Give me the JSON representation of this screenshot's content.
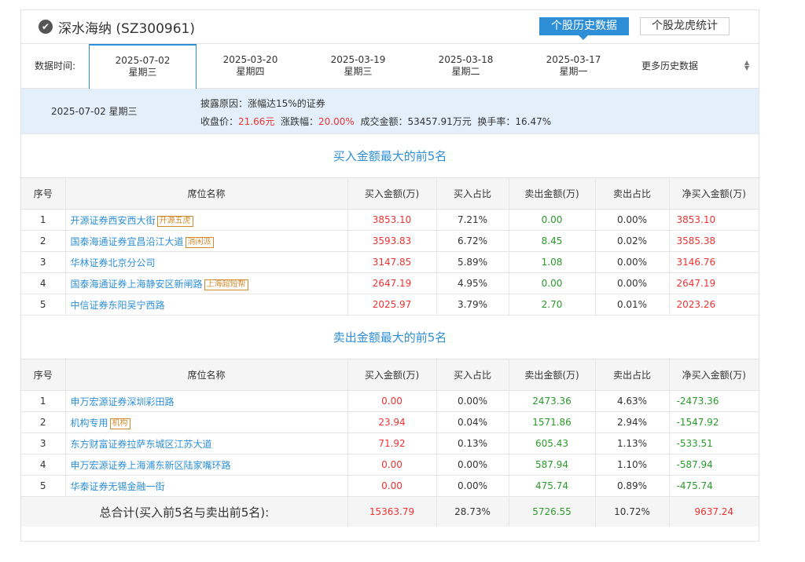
{
  "header": {
    "title": "深水海纳 (SZ300961)",
    "btn_history": "个股历史数据",
    "btn_lhb": "个股龙虎统计"
  },
  "datebar": {
    "label": "数据时间:",
    "tabs": [
      {
        "date": "2025-07-02",
        "weekday": "星期三"
      },
      {
        "date": "2025-03-20",
        "weekday": "星期四"
      },
      {
        "date": "2025-03-19",
        "weekday": "星期三"
      },
      {
        "date": "2025-03-18",
        "weekday": "星期二"
      },
      {
        "date": "2025-03-17",
        "weekday": "星期一"
      }
    ],
    "more": "更多历史数据"
  },
  "info": {
    "date": "2025-07-02  星期三",
    "reason_label": "披露原因：",
    "reason": "涨幅达15%的证券",
    "close_label": "收盘价：",
    "close": "21.66元",
    "change_label": "涨跌幅：",
    "change": "20.00%",
    "amount_label": "成交金额：",
    "amount": "53457.91万元",
    "turnover_label": "换手率：",
    "turnover": "16.47%"
  },
  "columns": [
    "序号",
    "席位名称",
    "买入金额(万)",
    "买入占比",
    "卖出金额(万)",
    "卖出占比",
    "净买入金额(万)"
  ],
  "buy": {
    "title": "买入金额最大的前5名",
    "rows": [
      {
        "no": "1",
        "name": "开源证券西安西大街",
        "tag": "开源五虎",
        "buy": "3853.10",
        "buy_pct": "7.21%",
        "sell": "0.00",
        "sell_pct": "0.00%",
        "net": "3853.10"
      },
      {
        "no": "2",
        "name": "国泰海通证券宜昌沿江大道",
        "tag": "消闲派",
        "buy": "3593.83",
        "buy_pct": "6.72%",
        "sell": "8.45",
        "sell_pct": "0.02%",
        "net": "3585.38"
      },
      {
        "no": "3",
        "name": "华林证券北京分公司",
        "tag": "",
        "buy": "3147.85",
        "buy_pct": "5.89%",
        "sell": "1.08",
        "sell_pct": "0.00%",
        "net": "3146.76"
      },
      {
        "no": "4",
        "name": "国泰海通证券上海静安区新闸路",
        "tag": "上海超短帮",
        "buy": "2647.19",
        "buy_pct": "4.95%",
        "sell": "0.00",
        "sell_pct": "0.00%",
        "net": "2647.19"
      },
      {
        "no": "5",
        "name": "中信证券东阳吴宁西路",
        "tag": "",
        "buy": "2025.97",
        "buy_pct": "3.79%",
        "sell": "2.70",
        "sell_pct": "0.01%",
        "net": "2023.26"
      }
    ]
  },
  "sell": {
    "title": "卖出金额最大的前5名",
    "rows": [
      {
        "no": "1",
        "name": "申万宏源证券深圳彩田路",
        "tag": "",
        "buy": "0.00",
        "buy_pct": "0.00%",
        "sell": "2473.36",
        "sell_pct": "4.63%",
        "net": "-2473.36"
      },
      {
        "no": "2",
        "name": "机构专用",
        "tag": "机构",
        "buy": "23.94",
        "buy_pct": "0.04%",
        "sell": "1571.86",
        "sell_pct": "2.94%",
        "net": "-1547.92"
      },
      {
        "no": "3",
        "name": "东方财富证券拉萨东城区江苏大道",
        "tag": "",
        "buy": "71.92",
        "buy_pct": "0.13%",
        "sell": "605.43",
        "sell_pct": "1.13%",
        "net": "-533.51"
      },
      {
        "no": "4",
        "name": "申万宏源证券上海浦东新区陆家嘴环路",
        "tag": "",
        "buy": "0.00",
        "buy_pct": "0.00%",
        "sell": "587.94",
        "sell_pct": "1.10%",
        "net": "-587.94"
      },
      {
        "no": "5",
        "name": "华泰证券无锡金融一街",
        "tag": "",
        "buy": "0.00",
        "buy_pct": "0.00%",
        "sell": "475.74",
        "sell_pct": "0.89%",
        "net": "-475.74"
      }
    ]
  },
  "total": {
    "label": "总合计(买入前5名与卖出前5名):",
    "buy": "15363.79",
    "buy_pct": "28.73%",
    "sell": "5726.55",
    "sell_pct": "10.72%",
    "net": "9637.24"
  },
  "colors": {
    "accent": "#2e8fd6",
    "red": "#ee3333",
    "green": "#2a9b2a",
    "info_bg": "#e3f0fb"
  }
}
